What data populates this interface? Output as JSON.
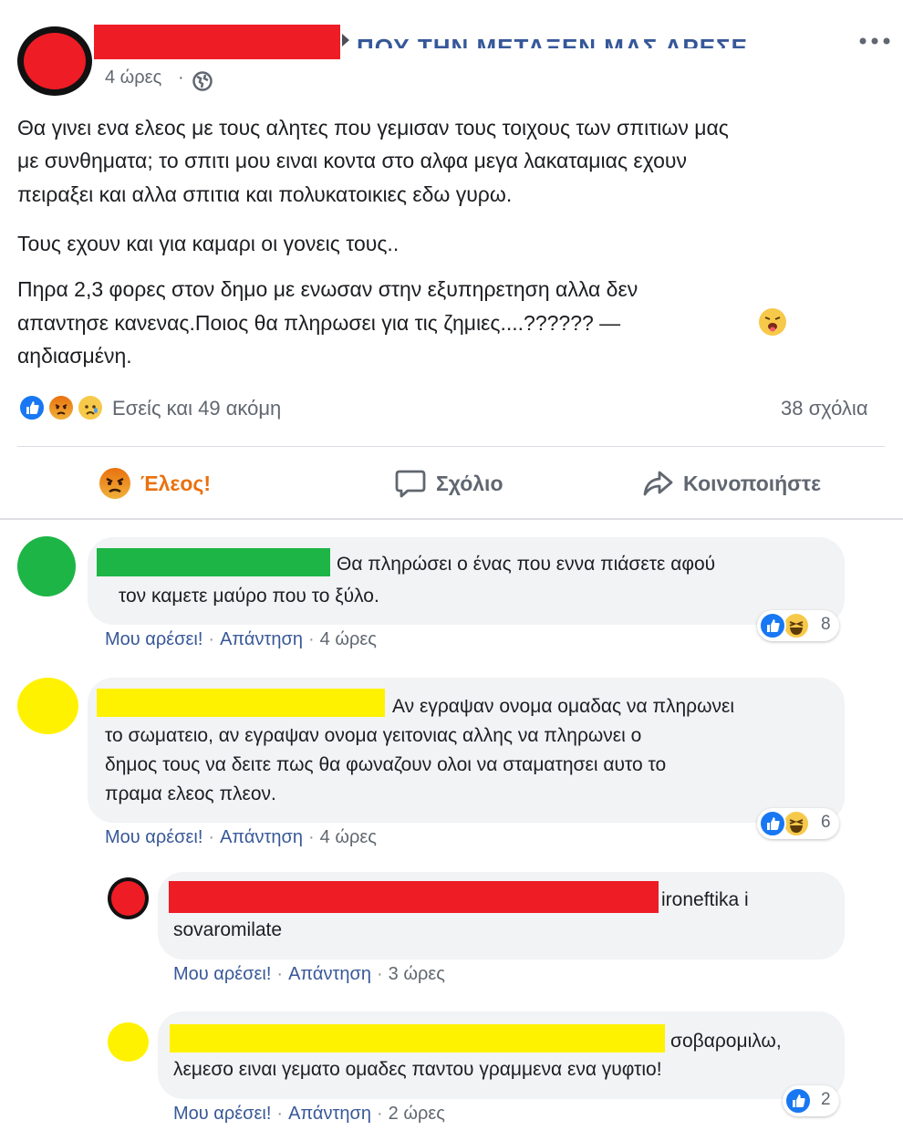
{
  "post": {
    "author_header": "ΠΟΥ ΤΗΝ ΜΕΤΑΞΕΝ ΜΑΣ ΑΡΕΣΕ",
    "time": "4 ώρες",
    "paragraphs": [
      [
        "Θα γινει ενα ελεος με τους αλητες που γεμισαν τους τοιχους των σπιτιων μας",
        "με συνθηματα; το σπιτι μου ειναι κοντα στο αλφα μεγα λακαταμιας εχουν",
        "πειραξει και αλλα σπιτια και πολυκατοικιες εδω γυρω."
      ],
      [
        "Τους εχουν και για καμαρι οι γονεις τους.."
      ],
      [
        "Πηρα 2,3 φορες στον δημο με ενωσαν στην εξυπηρετηση αλλα δεν",
        "απαντησε κανενας.Ποιος θα πληρωσει για τις ζημιες....?????? —",
        "αηδιασμένη."
      ]
    ],
    "reactions_text": "Εσείς και 49 ακόμη",
    "comments_count": "38 σχόλια",
    "actions": {
      "reaction_label": "Έλεος!",
      "comment_label": "Σχόλιο",
      "share_label": "Κοινοποιήστε"
    }
  },
  "comments": [
    {
      "lines": [
        "Θα πληρώσει ο ένας που εννα πιάσετε αφού",
        "τον καμετε μαύρο που το ξύλο."
      ],
      "like": "Μου αρέσει!",
      "reply": "Απάντηση",
      "time": "4 ώρες",
      "reaction_count": "8"
    },
    {
      "lines": [
        "Αν εγραψαν ονομα ομαδας να πληρωνει",
        "το σωματειο, αν εγραψαν ονομα γειτονιας αλλης να πληρωνει ο",
        "δημος τους να δειτε πως θα φωναζουν ολοι να σταματησει αυτο το",
        "πραμα ελεος πλεον."
      ],
      "like": "Μου αρέσει!",
      "reply": "Απάντηση",
      "time": "4 ώρες",
      "reaction_count": "6"
    },
    {
      "lines": [
        "ironeftika i",
        "sovaromilate"
      ],
      "like": "Μου αρέσει!",
      "reply": "Απάντηση",
      "time": "3 ώρες"
    },
    {
      "lines": [
        "σοβαρομιλω,",
        "λεμεσο ειναι γεματο ομαδες παντου γραμμενα ενα γυφτιο!"
      ],
      "like": "Μου αρέσει!",
      "reply": "Απάντηση",
      "time": "2 ώρες",
      "reaction_count": "2"
    }
  ],
  "colors": {
    "redaction_red": "#ee1c25",
    "redaction_green": "#1db546",
    "redaction_yellow": "#fff200",
    "link_blue": "#385898",
    "angry_orange": "#e9710f"
  },
  "icons": [
    "more-options-icon",
    "globe-icon",
    "like-reaction-icon",
    "angry-reaction-icon",
    "sad-reaction-icon",
    "haha-reaction-icon",
    "comment-bubble-icon",
    "share-arrow-icon",
    "disgusted-emoji-icon"
  ]
}
